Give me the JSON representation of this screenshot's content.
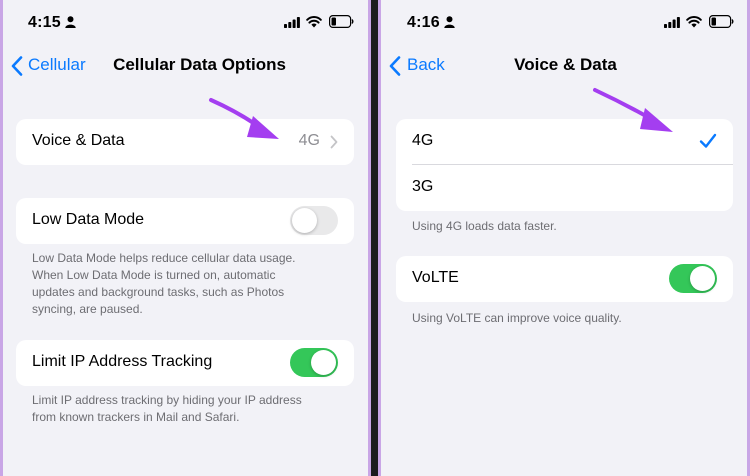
{
  "colors": {
    "accent": "#0a7aff",
    "toggle_on": "#34c759",
    "toggle_off": "#e9e9ea",
    "annotation_arrow": "#a43ef0",
    "background": "#f2f2f7",
    "secondary_text": "#6d6d72"
  },
  "left_screen": {
    "status_bar": {
      "time": "4:15",
      "icons": [
        "person-icon",
        "cellular-signal-icon",
        "wifi-icon",
        "battery-icon"
      ]
    },
    "nav": {
      "back_label": "Cellular",
      "title": "Cellular Data Options"
    },
    "voice_data_row": {
      "label": "Voice & Data",
      "value": "4G"
    },
    "low_data_mode": {
      "label": "Low Data Mode",
      "enabled": false,
      "footnote_lines": [
        "Low Data Mode helps reduce cellular data usage.",
        "When Low Data Mode is turned on, automatic",
        "updates and background tasks, such as Photos",
        "syncing, are paused."
      ]
    },
    "limit_ip_tracking": {
      "label": "Limit IP Address Tracking",
      "enabled": true,
      "footnote_lines": [
        "Limit IP address tracking by hiding your IP address",
        "from known trackers in Mail and Safari."
      ]
    }
  },
  "right_screen": {
    "status_bar": {
      "time": "4:16",
      "icons": [
        "person-icon",
        "cellular-signal-icon",
        "wifi-icon",
        "battery-icon"
      ]
    },
    "nav": {
      "back_label": "Back",
      "title": "Voice & Data"
    },
    "network_options": [
      {
        "label": "4G",
        "selected": true
      },
      {
        "label": "3G",
        "selected": false
      }
    ],
    "network_footnote": "Using 4G loads data faster.",
    "volte": {
      "label": "VoLTE",
      "enabled": true,
      "footnote": "Using VoLTE can improve voice quality."
    }
  }
}
